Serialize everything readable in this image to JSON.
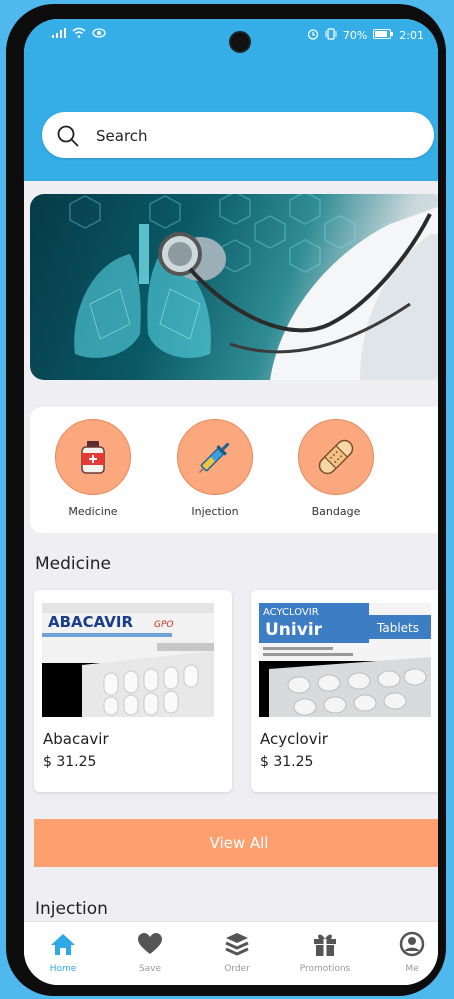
{
  "status": {
    "battery_text": "70%",
    "time": "2:01"
  },
  "search": {
    "placeholder": "Search"
  },
  "categories": [
    {
      "label": "Medicine",
      "icon": "medicine-bottle-icon"
    },
    {
      "label": "Injection",
      "icon": "syringe-icon"
    },
    {
      "label": "Bandage",
      "icon": "bandage-icon"
    }
  ],
  "sections": {
    "medicine_title": "Medicine",
    "injection_title": "Injection"
  },
  "products": [
    {
      "name": "Abacavir",
      "price": "$ 31.25",
      "box_brand": "ABACAVIR",
      "box_sub": "GPO"
    },
    {
      "name": "Acyclovir",
      "price": "$ 31.25",
      "box_brand": "ACYCLOVIR",
      "box_sub": "Univir",
      "box_tag": "Tablets"
    }
  ],
  "view_all_label": "View All",
  "bottom_nav": [
    {
      "label": "Home",
      "icon": "home-icon",
      "active": true
    },
    {
      "label": "Save",
      "icon": "heart-icon",
      "active": false
    },
    {
      "label": "Order",
      "icon": "layers-icon",
      "active": false
    },
    {
      "label": "Promotions",
      "icon": "gift-icon",
      "active": false
    },
    {
      "label": "Me",
      "icon": "user-circle-icon",
      "active": false
    }
  ],
  "colors": {
    "header": "#35aee8",
    "accent": "#fda070",
    "active_nav": "#2fa8e6"
  }
}
